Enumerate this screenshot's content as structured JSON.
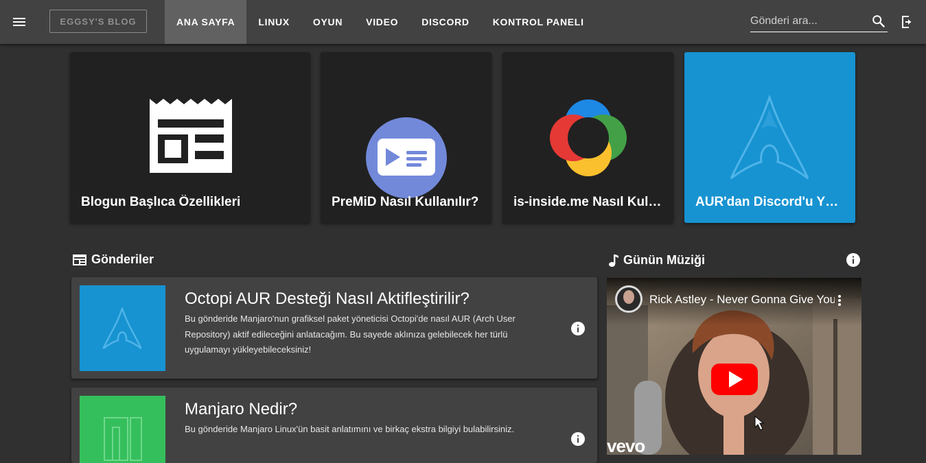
{
  "topbar": {
    "brand": "EGGSY'S BLOG",
    "nav": [
      "ANA SAYFA",
      "LINUX",
      "OYUN",
      "VIDEO",
      "DISCORD",
      "KONTROL PANELI"
    ],
    "active_nav": "ANA SAYFA",
    "search_placeholder": "Gönderi ara..."
  },
  "featured": [
    {
      "title": "Blogun Başlıca Özellikleri",
      "icon": "newspaper-icon",
      "bg": "#212121"
    },
    {
      "title": "PreMiD Nasıl Kullanılır?",
      "icon": "premid-logo",
      "bg": "#212121"
    },
    {
      "title": "is-inside.me Nasıl Kullanılır?",
      "icon": "sharex-logo",
      "bg": "#212121"
    },
    {
      "title": "AUR'dan Discord'u Yükleme",
      "icon": "arch-linux-logo",
      "bg": "#1793d1"
    }
  ],
  "posts_section": {
    "title": "Gönderiler"
  },
  "posts": [
    {
      "title": "Octopi AUR Desteği Nasıl Aktifleştirilir?",
      "description": "Bu gönderide Manjaro'nun grafiksel paket yöneticisi Octopi'de nasıl AUR (Arch User Repository) aktif edileceğini anlatacağım. Bu sayede aklınıza gelebilecek her türlü uygulamayı yükleyebileceksiniz!",
      "thumb_color": "#1793d1"
    },
    {
      "title": "Manjaro Nedir?",
      "description": "Bu gönderide Manjaro Linux'ün basit anlatımını ve birkaç ekstra bilgiyi bulabilirsiniz.",
      "thumb_color": "#35bf5c"
    }
  ],
  "music": {
    "title": "Günün Müziği",
    "video_title": "Rick Astley - Never Gonna Give You Up",
    "brand": "vevo"
  },
  "colors": {
    "background": "#303030",
    "topbar": "#424242",
    "card": "#212121",
    "post": "#424242",
    "arch_blue": "#1793d1",
    "manjaro_green": "#35bf5c"
  }
}
